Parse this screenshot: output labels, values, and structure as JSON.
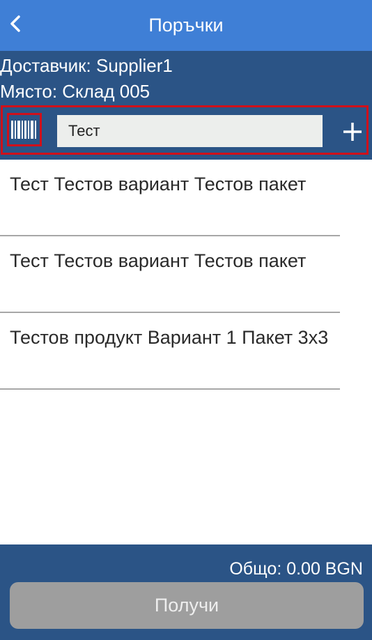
{
  "header": {
    "title": "Поръчки",
    "back_icon": "chevron-left-icon"
  },
  "info": {
    "supplier": "Доставчик: Supplier1",
    "location": "Място: Склад 005"
  },
  "search": {
    "value": "Тест",
    "barcode_icon": "barcode-icon",
    "add_icon": "plus-icon"
  },
  "products": [
    {
      "name": "Тест Тестов вариант Тестов пакет"
    },
    {
      "name": "Тест Тестов вариант Тестов пакет"
    },
    {
      "name": "Тестов продукт Вариант 1 Пакет 3x3"
    }
  ],
  "footer": {
    "total": "Общо: 0.00 BGN",
    "receive_label": "Получи"
  },
  "colors": {
    "app_bar": "#3f7fd6",
    "panel": "#2b5486",
    "highlight": "#d0101a",
    "disabled_button": "#9e9e9e"
  }
}
